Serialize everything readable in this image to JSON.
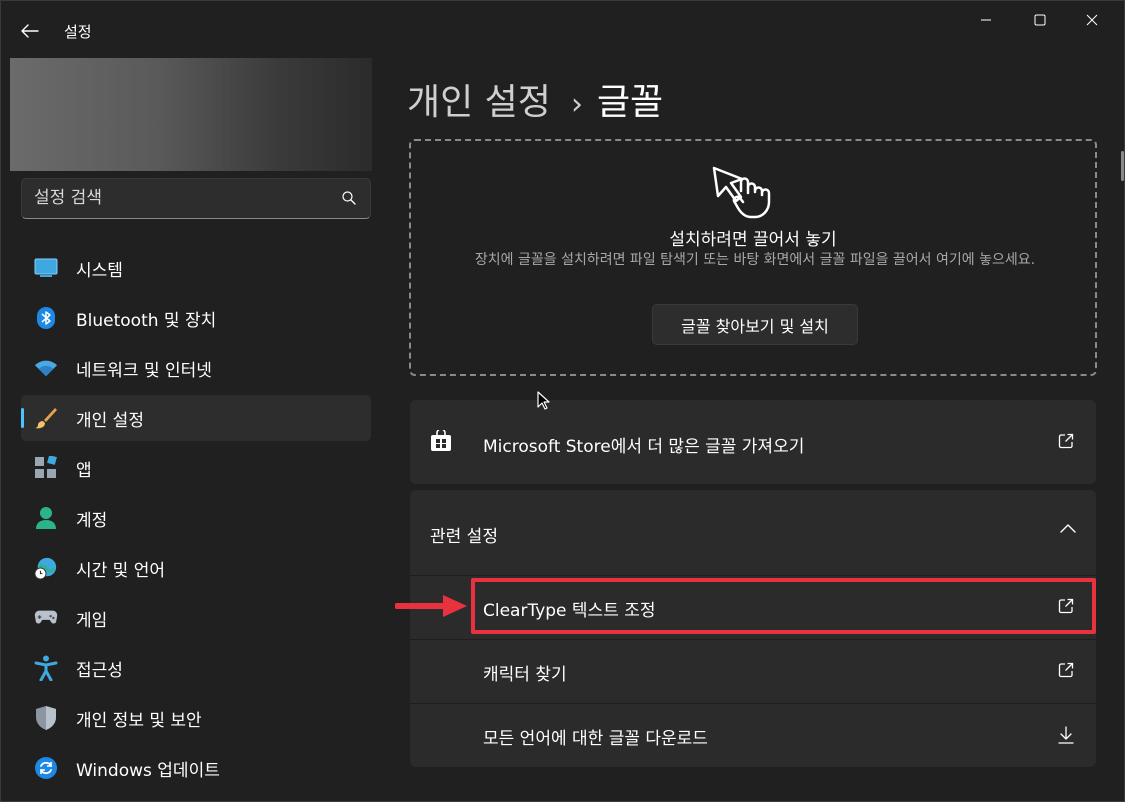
{
  "titlebar": {
    "title": "설정"
  },
  "search": {
    "placeholder": "설정 검색"
  },
  "sidebar": {
    "items": [
      {
        "label": "시스템",
        "icon": "system-icon"
      },
      {
        "label": "Bluetooth 및 장치",
        "icon": "bluetooth-icon"
      },
      {
        "label": "네트워크 및 인터넷",
        "icon": "wifi-icon"
      },
      {
        "label": "개인 설정",
        "icon": "brush-icon",
        "active": true
      },
      {
        "label": "앱",
        "icon": "apps-icon"
      },
      {
        "label": "계정",
        "icon": "account-icon"
      },
      {
        "label": "시간 및 언어",
        "icon": "time-language-icon"
      },
      {
        "label": "게임",
        "icon": "gaming-icon"
      },
      {
        "label": "접근성",
        "icon": "accessibility-icon"
      },
      {
        "label": "개인 정보 및 보안",
        "icon": "shield-icon"
      },
      {
        "label": "Windows 업데이트",
        "icon": "update-icon"
      }
    ]
  },
  "main": {
    "breadcrumb_parent": "개인 설정",
    "breadcrumb_separator": "›",
    "breadcrumb_current": "글꼴",
    "drop_zone": {
      "title": "설치하려면 끌어서 놓기",
      "description": "장치에 글꼴을 설치하려면 파일 탐색기 또는 바탕 화면에서 글꼴 파일을 끌어서 여기에 놓으세요.",
      "button_label": "글꼴 찾아보기 및 설치"
    },
    "store_card": {
      "label": "Microsoft Store에서 더 많은 글꼴 가져오기"
    },
    "related": {
      "title": "관련 설정",
      "items": [
        {
          "label": "ClearType 텍스트 조정",
          "icon": "external-link-icon"
        },
        {
          "label": "캐릭터 찾기",
          "icon": "external-link-icon"
        },
        {
          "label": "모든 언어에 대한 글꼴 다운로드",
          "icon": "download-icon"
        }
      ]
    }
  },
  "colors": {
    "accent": "#4cc2ff",
    "highlight": "#e8333f",
    "background": "#202020",
    "card": "#2b2b2b"
  }
}
